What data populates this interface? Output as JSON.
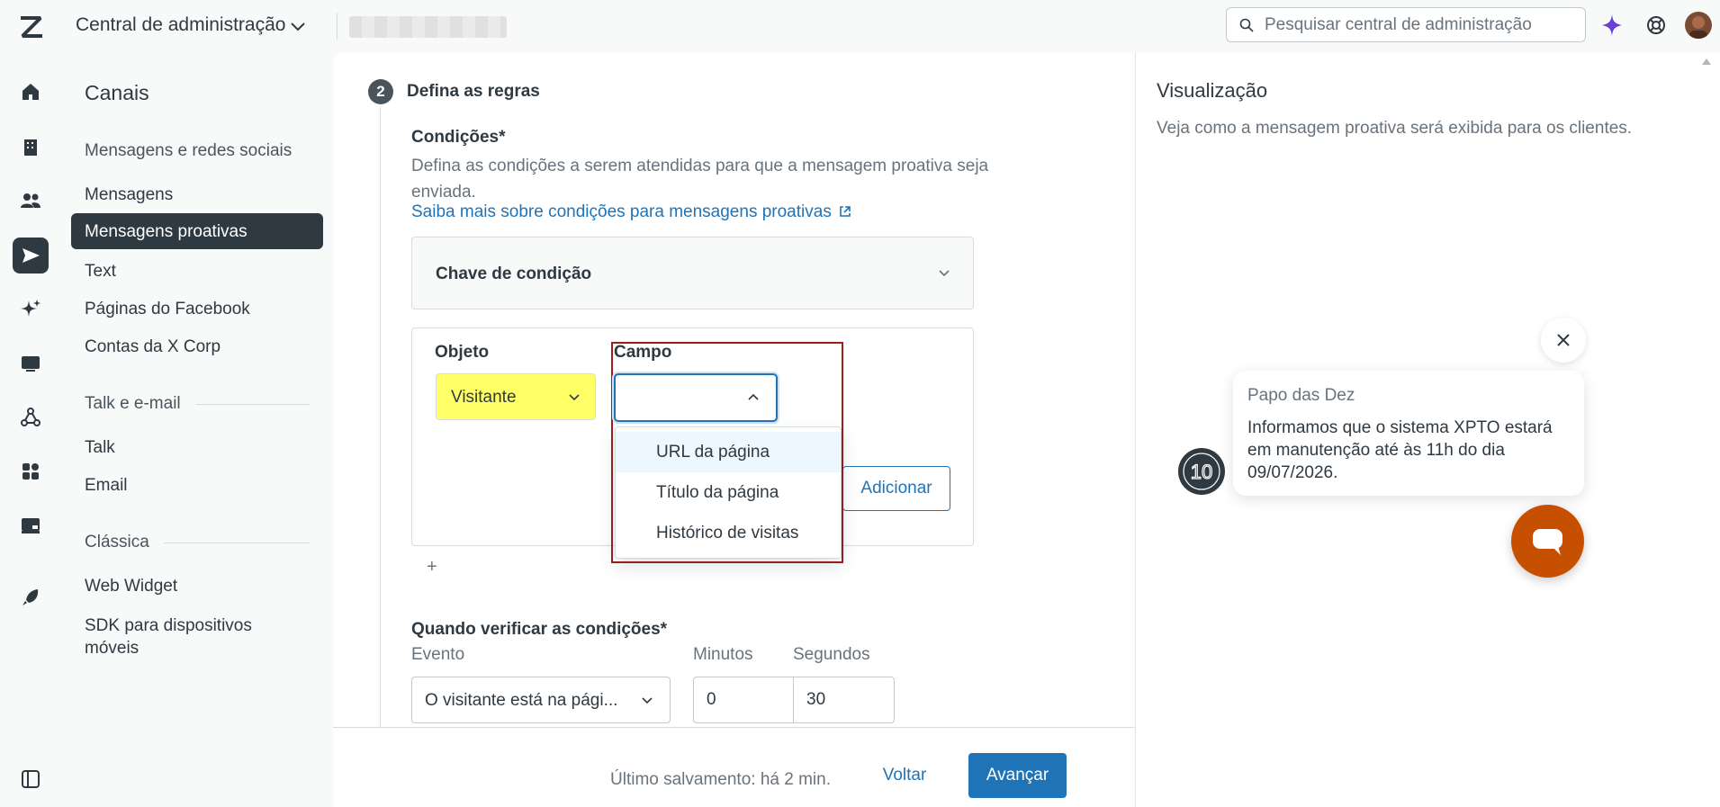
{
  "header": {
    "app_title": "Central de administração",
    "search_placeholder": "Pesquisar central de administração"
  },
  "nav": {
    "title": "Canais",
    "sections": [
      {
        "label": "Mensagens e redes sociais",
        "items": [
          "Mensagens",
          "Mensagens proativas",
          "Text",
          "Páginas do Facebook",
          "Contas da X Corp"
        ]
      },
      {
        "label": "Talk e e-mail",
        "items": [
          "Talk",
          "Email"
        ]
      },
      {
        "label": "Clássica",
        "items": [
          "Web Widget",
          "SDK para dispositivos móveis"
        ]
      }
    ],
    "active_item": "Mensagens proativas",
    "sdk_line1": "SDK para dispositivos",
    "sdk_line2": "móveis"
  },
  "step": {
    "number": "2",
    "title": "Defina as regras"
  },
  "conditions": {
    "label": "Condições*",
    "description": "Defina as condições a serem atendidas para que a mensagem proativa seja enviada.",
    "link": "Saiba mais sobre condições para mensagens proativas",
    "key_label": "Chave de condição",
    "object_label": "Objeto",
    "object_value": "Visitante",
    "field_label": "Campo",
    "field_value": "",
    "field_options": [
      "URL da página",
      "Título da página",
      "Histórico de visitas"
    ],
    "add_button": "Adicionar",
    "add_more": "+"
  },
  "when": {
    "label": "Quando verificar as condições*",
    "event_label": "Evento",
    "event_value": "O visitante está na pági...",
    "minutes_label": "Minutos",
    "minutes_value": "0",
    "seconds_label": "Segundos",
    "seconds_value": "30"
  },
  "footer": {
    "saved": "Último salvamento: há 2 min.",
    "back": "Voltar",
    "next": "Avançar"
  },
  "preview": {
    "title": "Visualização",
    "description": "Veja como a mensagem proativa será exibida para os clientes.",
    "sender": "Papo das Dez",
    "message": "Informamos que o sistema XPTO estará em manutenção até às 11h do dia 09/07/2026.",
    "avatar_text": "10"
  },
  "colors": {
    "accent": "#1f73b7",
    "highlight": "#ffff66",
    "launcher": "#c75000",
    "frame": "#a31a1a",
    "dark": "#2f3941"
  },
  "icons": [
    "zendesk-logo-icon",
    "chevron-down-icon",
    "search-icon",
    "sparkle-icon",
    "help-icon",
    "home-icon",
    "building-icon",
    "people-icon",
    "channels-icon",
    "ai-icon",
    "workspace-icon",
    "objects-icon",
    "apps-icon",
    "account-icon",
    "rocket-icon",
    "sidebar-toggle-icon",
    "external-link-icon",
    "chevron-up-icon",
    "close-icon",
    "chat-icon"
  ]
}
